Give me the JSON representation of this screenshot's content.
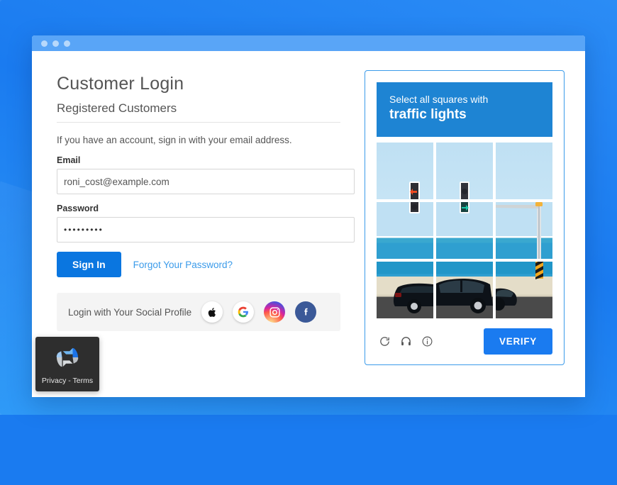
{
  "window": {
    "controls": [
      "close",
      "minimize",
      "maximize"
    ]
  },
  "login": {
    "page_title": "Customer Login",
    "section_title": "Registered Customers",
    "lead": "If you have an account, sign in with your email address.",
    "email_label": "Email",
    "email_value": "roni_cost@example.com",
    "email_placeholder": "Email",
    "password_label": "Password",
    "password_value": "•••••••••",
    "password_placeholder": "Password",
    "signin_label": "Sign In",
    "forgot_label": "Forgot Your Password?",
    "social_label": "Login with Your Social Profile",
    "social_icons": [
      "apple-icon",
      "google-icon",
      "instagram-icon",
      "facebook-icon"
    ],
    "accent_color": "#0a76e0",
    "link_color": "#3b9bea"
  },
  "captcha": {
    "prompt_line1": "Select all squares with",
    "prompt_line2": "traffic lights",
    "header_color": "#1e84d3",
    "border_color": "#3b9bea",
    "verify_label": "VERIFY",
    "verify_color": "#1a7bf0",
    "controls": [
      "reload-icon",
      "audio-icon",
      "info-icon"
    ],
    "tiles": [
      {
        "id": 1,
        "content": "sky with red arrow traffic light",
        "selected": false
      },
      {
        "id": 2,
        "content": "sky with dark traffic light",
        "selected": false
      },
      {
        "id": 3,
        "content": "clear sky",
        "selected": false
      },
      {
        "id": 4,
        "content": "sea horizon with dark traffic light",
        "selected": false
      },
      {
        "id": 5,
        "content": "sea horizon with green arrow traffic light",
        "selected": false
      },
      {
        "id": 6,
        "content": "sea horizon with lamp post",
        "selected": false
      },
      {
        "id": 7,
        "content": "black car rear on road",
        "selected": false
      },
      {
        "id": 8,
        "content": "black car body on road",
        "selected": false
      },
      {
        "id": 9,
        "content": "black car front with striped post",
        "selected": false
      }
    ]
  },
  "recaptcha_badge": {
    "label": "Privacy - Terms",
    "logo": "recaptcha-logo"
  }
}
